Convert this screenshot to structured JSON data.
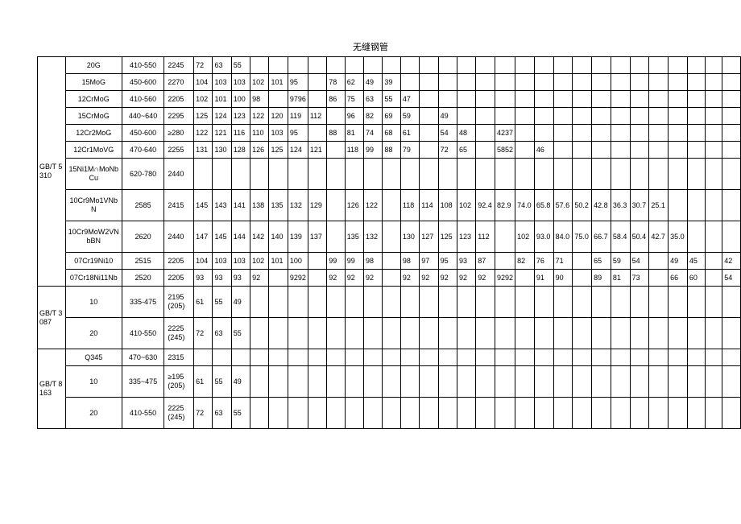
{
  "title": "无缝钢管",
  "groups": [
    {
      "std": "GB/T 5310",
      "rows": [
        {
          "grade": "20G",
          "range": "410-550",
          "c0": "2245",
          "c": [
            "72",
            "63",
            "55",
            "",
            "",
            "",
            "",
            "",
            "",
            "",
            "",
            "",
            "",
            "",
            "",
            "",
            "",
            "",
            "",
            "",
            "",
            "",
            "",
            "",
            "",
            "",
            "",
            "",
            ""
          ]
        },
        {
          "grade": "15MoG",
          "range": "450-600",
          "c0": "2270",
          "c": [
            "104",
            "103",
            "103",
            "102",
            "101",
            "95",
            "",
            "78",
            "62",
            "49",
            "39",
            "",
            "",
            "",
            "",
            "",
            "",
            "",
            "",
            "",
            "",
            "",
            "",
            "",
            "",
            "",
            "",
            "",
            ""
          ]
        },
        {
          "grade": "12CrMoG",
          "range": "410-560",
          "c0": "2205",
          "c": [
            "102",
            "101",
            "100",
            "98",
            "",
            "9796",
            "",
            "86",
            "75",
            "63",
            "55",
            "47",
            "",
            "",
            "",
            "",
            "",
            "",
            "",
            "",
            "",
            "",
            "",
            "",
            "",
            "",
            "",
            "",
            ""
          ]
        },
        {
          "grade": "15CrMoG",
          "range": "440~640",
          "c0": "2295",
          "c": [
            "125",
            "124",
            "123",
            "122",
            "120",
            "119",
            "112",
            "",
            "96",
            "82",
            "69",
            "59",
            "",
            "49",
            "",
            "",
            "",
            "",
            "",
            "",
            "",
            "",
            "",
            "",
            "",
            "",
            "",
            "",
            ""
          ]
        },
        {
          "grade": "12Cr2MoG",
          "range": "450-600",
          "c0": "≥280",
          "c": [
            "122",
            "121",
            "116",
            "110",
            "103",
            "95",
            "",
            "88",
            "81",
            "74",
            "68",
            "61",
            "",
            "54",
            "48",
            "",
            "4237",
            "",
            "",
            "",
            "",
            "",
            "",
            "",
            "",
            "",
            "",
            "",
            ""
          ]
        },
        {
          "grade": "12Cr1MoVG",
          "range": "470-640",
          "c0": "2255",
          "c": [
            "131",
            "130",
            "128",
            "126",
            "125",
            "124",
            "121",
            "",
            "118",
            "99",
            "88",
            "79",
            "",
            "72",
            "65",
            "",
            "5852",
            "",
            "46",
            "",
            "",
            "",
            "",
            "",
            "",
            "",
            "",
            "",
            ""
          ]
        },
        {
          "grade": "15Ni1M∩MoNbCu",
          "range": "620-780",
          "c0": "2440",
          "c": [
            "",
            "",
            "",
            "",
            "",
            "",
            "",
            "",
            "",
            "",
            "",
            "",
            "",
            "",
            "",
            "",
            "",
            "",
            "",
            "",
            "",
            "",
            "",
            "",
            "",
            "",
            "",
            "",
            ""
          ],
          "tall": true
        },
        {
          "grade": "10Cr9Mo1VNbN",
          "range": "2585",
          "c0": "2415",
          "c": [
            "145",
            "143",
            "141",
            "138",
            "135",
            "132",
            "129",
            "",
            "126",
            "122",
            "",
            "118",
            "114",
            "108",
            "102",
            "92.4",
            "82.9",
            "74.0",
            "65.8",
            "57.6",
            "50.2",
            "42.8",
            "36.3",
            "30.7",
            "25.1",
            "",
            "",
            "",
            ""
          ],
          "tall": true,
          "noRangeCol": false
        },
        {
          "grade": "10Cr9MoW2VNbBN",
          "range": "2620",
          "c0": "2440",
          "c": [
            "147",
            "145",
            "144",
            "142",
            "140",
            "139",
            "137",
            "",
            "135",
            "132",
            "",
            "130",
            "127",
            "125",
            "123",
            "112",
            "",
            "102",
            "93.0",
            "84.0",
            "75.0",
            "66.7",
            "58.4",
            "50.4",
            "42.7",
            "35.0",
            "",
            "",
            ""
          ],
          "tall": true
        },
        {
          "grade": "07Cr19Ni10",
          "range": "2515",
          "c0": "2205",
          "c": [
            "104",
            "103",
            "103",
            "102",
            "101",
            "100",
            "",
            "99",
            "99",
            "98",
            "",
            "98",
            "97",
            "95",
            "93",
            "87",
            "",
            "82",
            "76",
            "71",
            "",
            "65",
            "59",
            "54",
            "",
            "49",
            "45",
            "",
            "42"
          ]
        },
        {
          "grade": "07Cr18Ni11Nb",
          "range": "2520",
          "c0": "2205",
          "c": [
            "93",
            "93",
            "93",
            "92",
            "",
            "9292",
            "",
            "92",
            "92",
            "92",
            "",
            "92",
            "92",
            "92",
            "92",
            "92",
            "9292",
            "",
            "91",
            "90",
            "",
            "89",
            "81",
            "73",
            "",
            "66",
            "60",
            "",
            "54"
          ]
        }
      ]
    },
    {
      "std": "GB/T 3087",
      "rows": [
        {
          "grade": "10",
          "range": "335-475",
          "c0": "2195 (205)",
          "c": [
            "61",
            "55",
            "49",
            "",
            "",
            "",
            "",
            "",
            "",
            "",
            "",
            "",
            "",
            "",
            "",
            "",
            "",
            "",
            "",
            "",
            "",
            "",
            "",
            "",
            "",
            "",
            "",
            "",
            ""
          ],
          "tall": true
        },
        {
          "grade": "20",
          "range": "410-550",
          "c0": "2225 (245)",
          "c": [
            "72",
            "63",
            "55",
            "",
            "",
            "",
            "",
            "",
            "",
            "",
            "",
            "",
            "",
            "",
            "",
            "",
            "",
            "",
            "",
            "",
            "",
            "",
            "",
            "",
            "",
            "",
            "",
            "",
            ""
          ],
          "tall": true
        }
      ]
    },
    {
      "std": "GB/T 8163",
      "rows": [
        {
          "grade": "Q345",
          "range": "470~630",
          "c0": "2315",
          "c": [
            "",
            "",
            "",
            "",
            "",
            "",
            "",
            "",
            "",
            "",
            "",
            "",
            "",
            "",
            "",
            "",
            "",
            "",
            "",
            "",
            "",
            "",
            "",
            "",
            "",
            "",
            "",
            "",
            ""
          ]
        },
        {
          "grade": "10",
          "range": "335~475",
          "c0": "≥195 (205)",
          "c": [
            "61",
            "55",
            "49",
            "",
            "",
            "",
            "",
            "",
            "",
            "",
            "",
            "",
            "",
            "",
            "",
            "",
            "",
            "",
            "",
            "",
            "",
            "",
            "",
            "",
            "",
            "",
            "",
            "",
            ""
          ],
          "tall": true
        },
        {
          "grade": "20",
          "range": "410-550",
          "c0": "2225 (245)",
          "c": [
            "72",
            "63",
            "55",
            "",
            "",
            "",
            "",
            "",
            "",
            "",
            "",
            "",
            "",
            "",
            "",
            "",
            "",
            "",
            "",
            "",
            "",
            "",
            "",
            "",
            "",
            "",
            "",
            "",
            ""
          ],
          "tall": true
        }
      ]
    }
  ]
}
